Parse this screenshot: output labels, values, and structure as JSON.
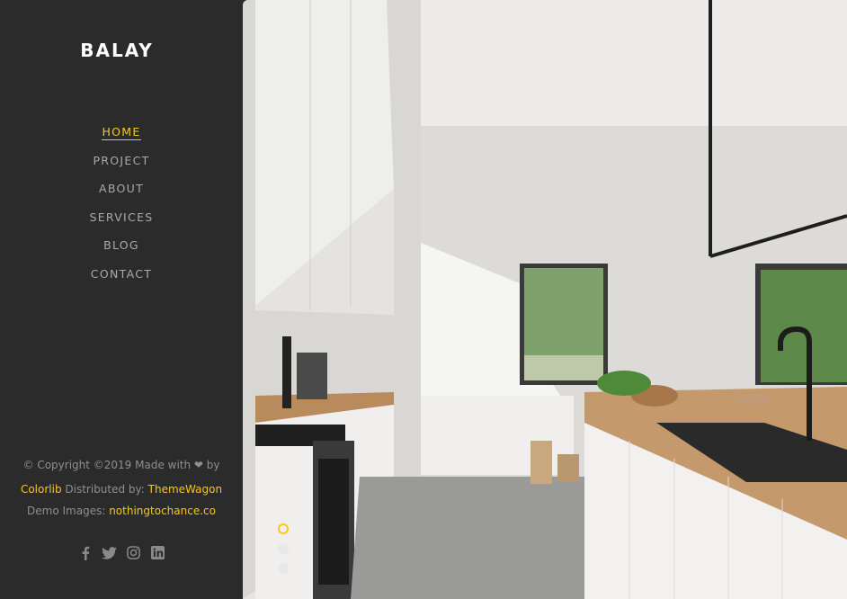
{
  "brand": "BALAY",
  "nav": [
    {
      "label": "HOME",
      "active": true
    },
    {
      "label": "PROJECT"
    },
    {
      "label": "ABOUT"
    },
    {
      "label": "SERVICES"
    },
    {
      "label": "BLOG"
    },
    {
      "label": "CONTACT"
    }
  ],
  "footer": {
    "copyright": "© Copyright ©2019 Made with ❤ by",
    "colorlib": "Colorlib",
    "distributed": " Distributed by: ",
    "themewagon": "ThemeWagon",
    "demo": "Demo Images: ",
    "nothingtochance": "nothingtochance.co"
  },
  "social": [
    "facebook-icon",
    "twitter-icon",
    "instagram-icon",
    "linkedin-icon"
  ],
  "slider": {
    "current": 1,
    "total": 3
  },
  "colors": {
    "accent": "#f8c913",
    "sidebar": "#2b2b2b"
  }
}
